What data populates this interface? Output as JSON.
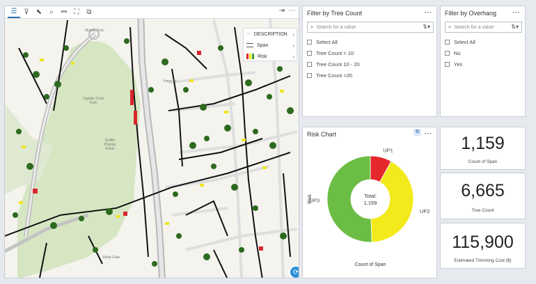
{
  "map": {
    "street_labels": [
      "Murray Cres",
      "Hann St",
      "Captain Cook Park",
      "Griffith Playing Fields",
      "Wade Gate"
    ],
    "legend": {
      "description_label": "DESCRIPTION",
      "items": [
        {
          "label": "Span",
          "colors": [
            "#555555"
          ]
        },
        {
          "label": "Risk",
          "colors": [
            "#d9262c",
            "#efe51d",
            "#3d9e34"
          ]
        }
      ]
    },
    "toolbar_tools": [
      "legend-icon",
      "filter-icon",
      "select-icon",
      "zoom-icon",
      "network-icon",
      "fullscreen-icon",
      "extent-icon"
    ]
  },
  "filters": [
    {
      "title": "Filter by Tree Count",
      "search_placeholder": "Search for a value",
      "options": [
        "Select All",
        "Tree Count < 10",
        "Tree Count 10 - 20",
        "Tree Count >20"
      ]
    },
    {
      "title": "Filter by Overhang",
      "search_placeholder": "Search for a value",
      "options": [
        "Select All",
        "No",
        "Yes"
      ]
    }
  ],
  "risk_chart": {
    "title": "Risk Chart",
    "center_label": "Total:",
    "center_value": "1,159",
    "chart_data": {
      "type": "pie",
      "donut": true,
      "title": "Risk Chart",
      "xlabel": "Count of Span",
      "ylabel": "Risk",
      "categories": [
        "UP1",
        "UP2",
        "UP3"
      ],
      "values": [
        93,
        480,
        586
      ],
      "colors": [
        "#e5282e",
        "#f2ea1b",
        "#6cbd45"
      ]
    }
  },
  "kpis": [
    {
      "value": "1,159",
      "label": "Count of Span"
    },
    {
      "value": "6,665",
      "label": "Tree Count"
    },
    {
      "value": "115,900",
      "label": "Estimated Trimming Cost ($)"
    }
  ]
}
